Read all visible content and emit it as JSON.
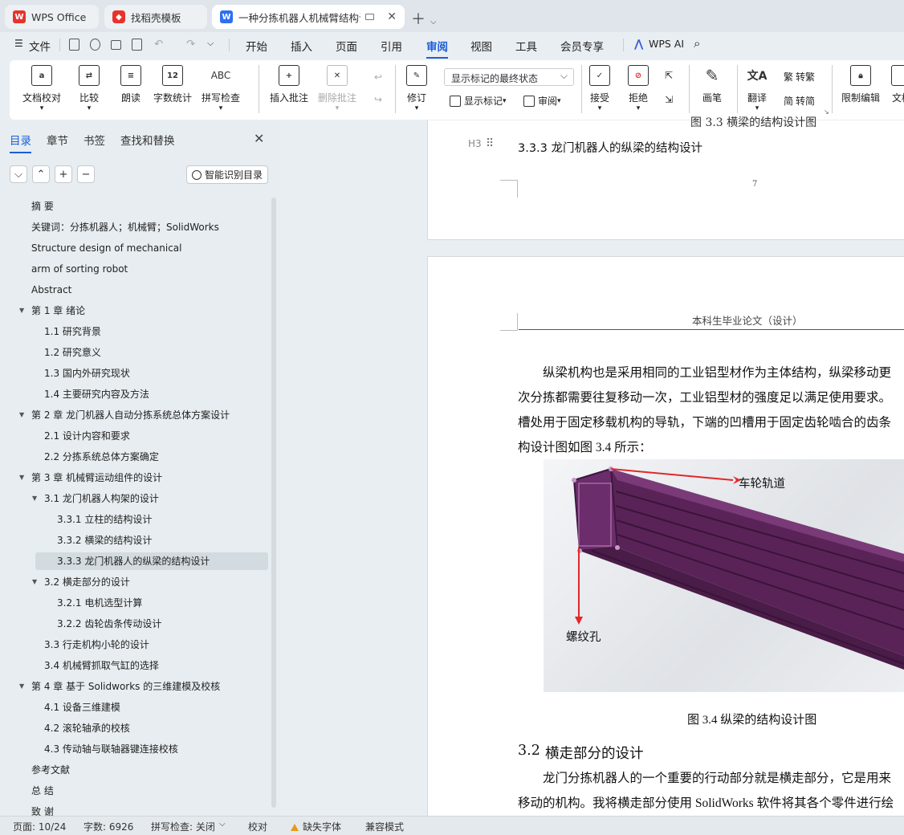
{
  "tabs": [
    {
      "label": "WPS Office"
    },
    {
      "label": "找稻壳模板"
    },
    {
      "label": "一种分拣机器人机械臂结构设计"
    }
  ],
  "menu": {
    "file": "文件",
    "items": [
      "开始",
      "插入",
      "页面",
      "引用",
      "审阅",
      "视图",
      "工具",
      "会员专享"
    ],
    "active": "审阅",
    "ai": "WPS AI"
  },
  "ribbon": {
    "doc_check": "文档校对",
    "compare": "比较",
    "read_aloud": "朗读",
    "word_count": "字数统计",
    "spell_check": "拼写检查",
    "insert_comment": "插入批注",
    "delete_comment": "删除批注",
    "revise": "修订",
    "markup_select": "显示标记的最终状态",
    "show_markup": "显示标记",
    "review": "审阅",
    "accept": "接受",
    "reject": "拒绝",
    "draw": "画笔",
    "translate": "翻译",
    "to_traditional": "转繁",
    "to_simplified": "转简",
    "restrict_edit": "限制编辑",
    "doc_more": "文档",
    "abc": "ABC",
    "num12": "12"
  },
  "panel": {
    "tabs": [
      "目录",
      "章节",
      "书签",
      "查找和替换"
    ],
    "smart_toc": "智能识别目录",
    "toc": [
      {
        "label": "摘  要",
        "level": 0
      },
      {
        "label": "关键词：分拣机器人；机械臂；SolidWorks",
        "level": 0
      },
      {
        "label": "Structure design of mechanical",
        "level": 0
      },
      {
        "label": "arm of sorting robot",
        "level": 0
      },
      {
        "label": "Abstract",
        "level": 0
      },
      {
        "label": "第 1 章  绪论",
        "level": 0,
        "expand": true
      },
      {
        "label": "1.1  研究背景",
        "level": 1
      },
      {
        "label": "1.2  研究意义",
        "level": 1
      },
      {
        "label": "1.3  国内外研究现状",
        "level": 1
      },
      {
        "label": "1.4  主要研究内容及方法",
        "level": 1
      },
      {
        "label": "第 2 章  龙门机器人自动分拣系统总体方案设计",
        "level": 0,
        "expand": true
      },
      {
        "label": "2.1 设计内容和要求",
        "level": 1
      },
      {
        "label": "2.2 分拣系统总体方案确定",
        "level": 1
      },
      {
        "label": "第 3 章  机械臂运动组件的设计",
        "level": 0,
        "expand": true
      },
      {
        "label": "3.1 龙门机器人构架的设计",
        "level": 1,
        "expand": true
      },
      {
        "label": "3.3.1 立柱的结构设计",
        "level": 2
      },
      {
        "label": "3.3.2 横梁的结构设计",
        "level": 2
      },
      {
        "label": "3.3.3 龙门机器人的纵梁的结构设计",
        "level": 2,
        "selected": true
      },
      {
        "label": "3.2  横走部分的设计",
        "level": 1,
        "expand": true
      },
      {
        "label": "3.2.1 电机选型计算",
        "level": 2
      },
      {
        "label": "3.2.2 齿轮齿条传动设计",
        "level": 2
      },
      {
        "label": "3.3  行走机构小轮的设计",
        "level": 1
      },
      {
        "label": "3.4  机械臂抓取气缸的选择",
        "level": 1
      },
      {
        "label": "第 4 章  基于 Solidworks 的三维建模及校核",
        "level": 0,
        "expand": true
      },
      {
        "label": "4.1  设备三维建模",
        "level": 1
      },
      {
        "label": "4.2  滚轮轴承的校核",
        "level": 1
      },
      {
        "label": "4.3 传动轴与联轴器键连接校核",
        "level": 1
      },
      {
        "label": "参考文献",
        "level": 0
      },
      {
        "label": "总   结",
        "level": 0
      },
      {
        "label": "致   谢",
        "level": 0
      }
    ]
  },
  "doc": {
    "prev_caption": "图 3.3 横梁的结构设计图",
    "heading_marker": "H3",
    "heading": "3.3.3 龙门机器人的纵梁的结构设计",
    "page_number": "7",
    "page_header": "本科生毕业论文（设计）",
    "para_lines": [
      "纵梁机构也是采用相同的工业铝型材作为主体结构，纵梁移动更",
      "次分拣都需要往复移动一次，工业铝型材的强度足以满足使用要求。",
      "槽处用于固定移载机构的导轨，下端的凹槽用于固定齿轮啮合的齿条",
      "构设计图如图 3.4 所示："
    ],
    "fig_label_track": "车轮轨道",
    "fig_label_hole": "螺纹孔",
    "caption": "图 3.4 纵梁的结构设计图",
    "section_num": "3.2",
    "section_title": "横走部分的设计",
    "para2_lines": [
      "龙门分拣机器人的一个重要的行动部分就是横走部分，它是用来",
      "移动的机构。我将横走部分使用 SolidWorks 软件将其各个零件进行绘"
    ]
  },
  "status": {
    "page": "页面: 10/24",
    "words": "字数: 6926",
    "spell": "拼写检查: 关闭",
    "proof": "校对",
    "missing_font": "缺失字体",
    "compat": "兼容模式"
  },
  "colors": {
    "accent": "#1b5fd6",
    "profile": "#6b2d6b",
    "arrow": "#e0272b"
  }
}
